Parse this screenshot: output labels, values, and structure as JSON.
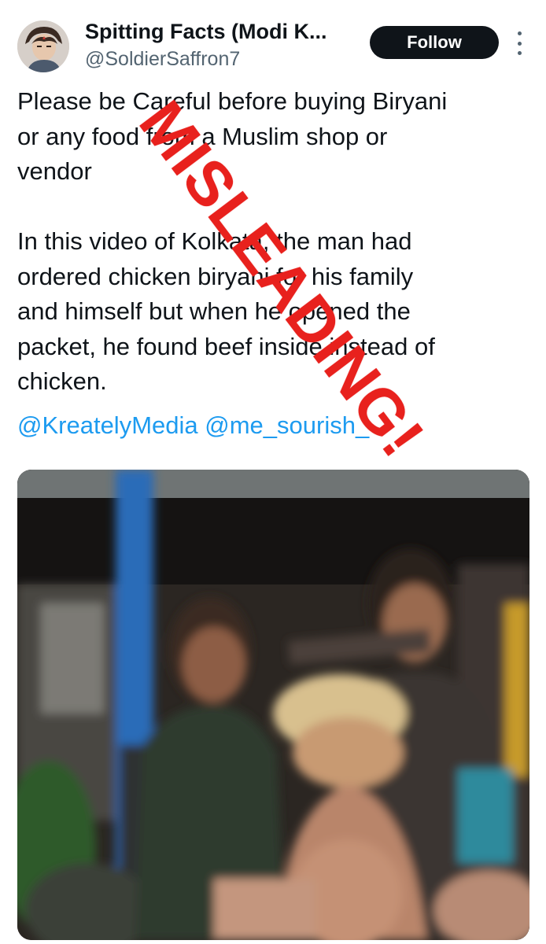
{
  "tweet": {
    "author": {
      "display_name": "Spitting Facts (Modi K...",
      "handle": "@SoldierSaffron7"
    },
    "follow_label": "Follow",
    "text_lines": [
      "Please be Careful before buying Biryani",
      "or any food from a Muslim shop or",
      "vendor",
      "",
      "In this video of Kolkata, the man had",
      "ordered chicken biryani for his family",
      "and himself but when he opened the",
      "packet, he found beef inside instead of",
      "chicken."
    ],
    "mentions": [
      "@KreatelyMedia",
      "@me_sourish_"
    ]
  },
  "stamp": {
    "text": "MISLEADING!",
    "color": "#e8211d"
  },
  "colors": {
    "link": "#1d9bf0",
    "text": "#0f1419",
    "secondary": "#536471",
    "follow_bg": "#0f1419"
  },
  "icons": {
    "more": "more-options-icon"
  }
}
